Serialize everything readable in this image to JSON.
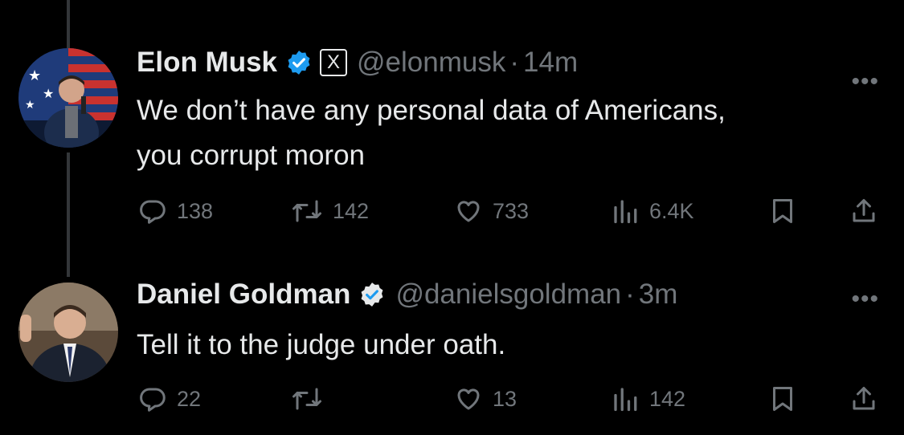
{
  "tweets": [
    {
      "name": "Elon Musk",
      "verified": true,
      "affiliate_badge": "X",
      "handle": "@elonmusk",
      "dot": "·",
      "time": "14m",
      "more": "•••",
      "text_line1": "We don’t have any personal data of Americans,",
      "text_line2": "you corrupt moron",
      "replies": "138",
      "reposts": "142",
      "likes": "733",
      "views": "6.4K"
    },
    {
      "name": "Daniel Goldman",
      "verified": true,
      "handle": "@danielsgoldman",
      "dot": "·",
      "time": "3m",
      "more": "•••",
      "text_line1": "Tell it to the judge under oath.",
      "replies": "22",
      "reposts": "",
      "likes": "13",
      "views": "142"
    }
  ],
  "colors": {
    "background": "#000000",
    "text": "#e7e9ea",
    "muted": "#71767b",
    "verified_blue": "#1d9bf0"
  },
  "icons": [
    "reply-icon",
    "repost-icon",
    "like-icon",
    "views-icon",
    "bookmark-icon",
    "share-icon",
    "more-icon",
    "verified-badge-icon",
    "x-affiliate-icon"
  ]
}
